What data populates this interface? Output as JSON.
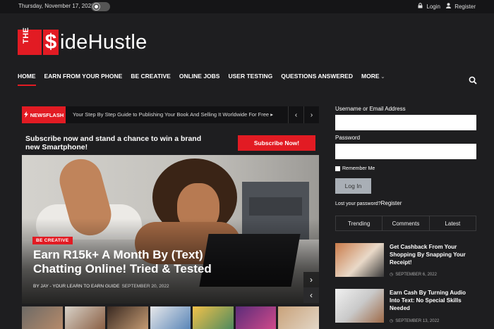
{
  "topbar": {
    "date": "Thursday, November 17, 2022",
    "login": "Login",
    "register": "Register"
  },
  "logo": {
    "the": "THE",
    "s": "$",
    "name": "ideHustle"
  },
  "nav": {
    "items": [
      "HOME",
      "EARN FROM YOUR PHONE",
      "BE CREATIVE",
      "ONLINE JOBS",
      "USER TESTING",
      "QUESTIONS ANSWERED",
      "MORE"
    ],
    "chevron": "⌄"
  },
  "newsflash": {
    "badge": "NEWSFLASH",
    "text": "Your Step By Step Guide to Publishing Your Book And Selling It Worldwide For Free",
    "sep": "▸",
    "prev": "‹",
    "next": "›"
  },
  "subscribe": {
    "text": "Subscribe now and stand a chance to win a brand new Smartphone!",
    "button": "Subscribe Now!"
  },
  "hero": {
    "category": "BE CREATIVE",
    "headline": "Earn R15k+ A Month By (Text) Chatting Online! Tried & Tested",
    "author": "BY JAY - YOUR LEARN TO EARN GUIDE",
    "date": "SEPTEMBER 20, 2022",
    "next": "›",
    "prev": "‹"
  },
  "login": {
    "username_label": "Username or Email Address",
    "password_label": "Password",
    "remember": "Remember Me",
    "button": "Log In",
    "lost": "Lost your password?",
    "register": "Register"
  },
  "tabs": [
    "Trending",
    "Comments",
    "Latest"
  ],
  "posts": [
    {
      "title": "Get Cashback From Your Shopping By Snapping Your Receipt!",
      "date": "SEPTEMBER 6, 2022"
    },
    {
      "title": "Earn Cash By Turning Audio Into Text: No Special Skills Needed",
      "date": "SEPTEMBER 13, 2022"
    }
  ],
  "colors": {
    "accent": "#e21b23",
    "background": "#1e1e20",
    "topbar": "#151517"
  }
}
